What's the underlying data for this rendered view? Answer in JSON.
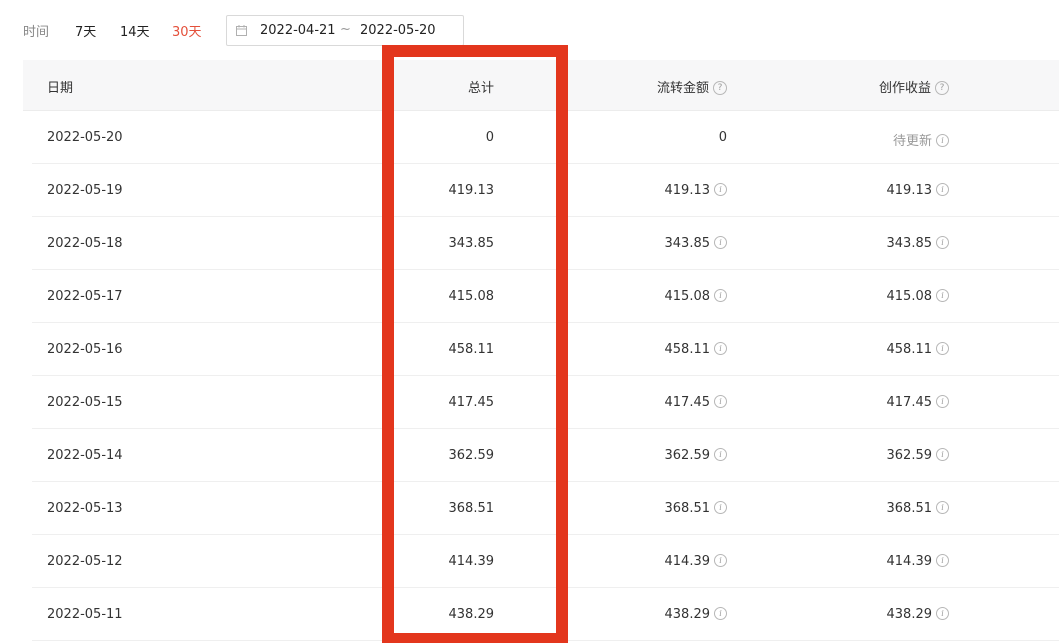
{
  "filter": {
    "label": "时间",
    "ranges": [
      "7天",
      "14天",
      "30天"
    ],
    "active_range": "30天",
    "date_start": "2022-04-21",
    "date_separator": "~",
    "date_end": "2022-05-20"
  },
  "table": {
    "headers": {
      "date": "日期",
      "total": "总计",
      "flow": "流转金额",
      "income": "创作收益"
    },
    "rows": [
      {
        "date": "2022-05-20",
        "total": "0",
        "flow": "0",
        "income": "待更新"
      },
      {
        "date": "2022-05-19",
        "total": "419.13",
        "flow": "419.13",
        "income": "419.13"
      },
      {
        "date": "2022-05-18",
        "total": "343.85",
        "flow": "343.85",
        "income": "343.85"
      },
      {
        "date": "2022-05-17",
        "total": "415.08",
        "flow": "415.08",
        "income": "415.08"
      },
      {
        "date": "2022-05-16",
        "total": "458.11",
        "flow": "458.11",
        "income": "458.11"
      },
      {
        "date": "2022-05-15",
        "total": "417.45",
        "flow": "417.45",
        "income": "417.45"
      },
      {
        "date": "2022-05-14",
        "total": "362.59",
        "flow": "362.59",
        "income": "362.59"
      },
      {
        "date": "2022-05-13",
        "total": "368.51",
        "flow": "368.51",
        "income": "368.51"
      },
      {
        "date": "2022-05-12",
        "total": "414.39",
        "flow": "414.39",
        "income": "414.39"
      },
      {
        "date": "2022-05-11",
        "total": "438.29",
        "flow": "438.29",
        "income": "438.29"
      }
    ]
  },
  "colors": {
    "active_range": "#e4503b",
    "highlight_box": "#e3361d",
    "header_bg": "#f7f7f8",
    "muted_text": "#999999"
  },
  "icons": {
    "calendar": "calendar-icon",
    "header_help": "help-circle-icon",
    "cell_info": "info-circle-icon"
  }
}
